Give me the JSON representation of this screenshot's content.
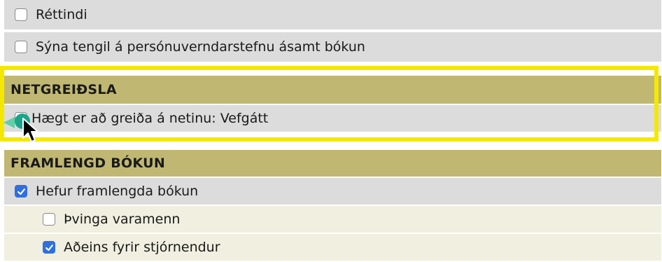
{
  "rows": {
    "rettindi": {
      "label": "Réttindi",
      "checked": false
    },
    "synatengil": {
      "label": "Sýna tengil á persónuverndarstefnu ásamt bókun",
      "checked": false
    }
  },
  "netgreidsla": {
    "header": "NETGREIÐSLA",
    "item": {
      "label": "Hægt er að greiða á netinu: Vefgátt",
      "checked": false
    }
  },
  "framlengd": {
    "header": "FRAMLENGD BÓKUN",
    "items": [
      {
        "label": "Hefur framlengda bókun",
        "checked": true
      },
      {
        "label": "Þvinga varamenn",
        "checked": false
      },
      {
        "label": "Aðeins fyrir stjórnendur",
        "checked": true
      }
    ]
  },
  "colors": {
    "header_bg": "#c0b872",
    "row_bg": "#dcdcdc",
    "sub_row_bg": "#f0efe0",
    "highlight": "#f5e800",
    "checkbox_checked": "#2f6fe0"
  }
}
